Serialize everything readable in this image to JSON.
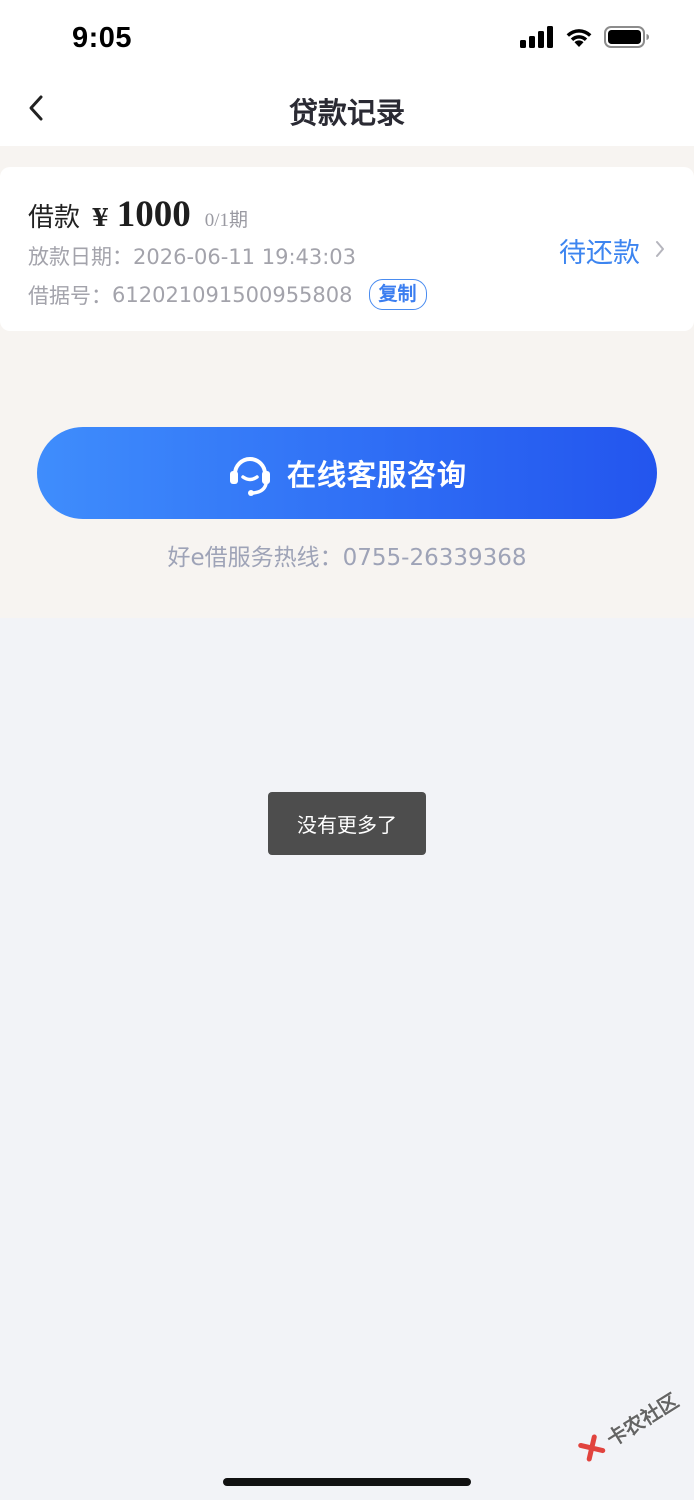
{
  "status_bar": {
    "time": "9:05",
    "icons": [
      "cellular-signal-icon",
      "wifi-icon",
      "battery-icon"
    ]
  },
  "nav": {
    "title": "贷款记录",
    "back_icon": "chevron-left-icon"
  },
  "loan": {
    "label": "借款",
    "currency": "¥",
    "amount": "1000",
    "period": "0/1期",
    "date_label": "放款日期：",
    "date_value": "2026-06-11 19:43:03",
    "no_label": "借据号：",
    "no_value": "612021091500955808",
    "copy_label": "复制",
    "status": "待还款",
    "status_color": "#3d85f0"
  },
  "service": {
    "button_label": "在线客服咨询",
    "icon": "headset-icon",
    "hotline_label": "好e借服务热线：",
    "hotline_number": "0755-26339368",
    "button_color": "#2f6ef5"
  },
  "toast": {
    "text": "没有更多了"
  },
  "watermark": {
    "text": "卡农社区"
  }
}
